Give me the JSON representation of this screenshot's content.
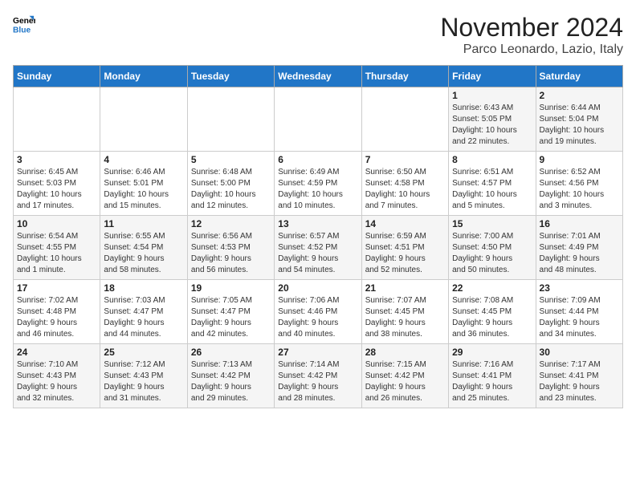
{
  "header": {
    "logo_line1": "General",
    "logo_line2": "Blue",
    "month": "November 2024",
    "location": "Parco Leonardo, Lazio, Italy"
  },
  "days_of_week": [
    "Sunday",
    "Monday",
    "Tuesday",
    "Wednesday",
    "Thursday",
    "Friday",
    "Saturday"
  ],
  "weeks": [
    [
      {
        "day": "",
        "info": ""
      },
      {
        "day": "",
        "info": ""
      },
      {
        "day": "",
        "info": ""
      },
      {
        "day": "",
        "info": ""
      },
      {
        "day": "",
        "info": ""
      },
      {
        "day": "1",
        "info": "Sunrise: 6:43 AM\nSunset: 5:05 PM\nDaylight: 10 hours\nand 22 minutes."
      },
      {
        "day": "2",
        "info": "Sunrise: 6:44 AM\nSunset: 5:04 PM\nDaylight: 10 hours\nand 19 minutes."
      }
    ],
    [
      {
        "day": "3",
        "info": "Sunrise: 6:45 AM\nSunset: 5:03 PM\nDaylight: 10 hours\nand 17 minutes."
      },
      {
        "day": "4",
        "info": "Sunrise: 6:46 AM\nSunset: 5:01 PM\nDaylight: 10 hours\nand 15 minutes."
      },
      {
        "day": "5",
        "info": "Sunrise: 6:48 AM\nSunset: 5:00 PM\nDaylight: 10 hours\nand 12 minutes."
      },
      {
        "day": "6",
        "info": "Sunrise: 6:49 AM\nSunset: 4:59 PM\nDaylight: 10 hours\nand 10 minutes."
      },
      {
        "day": "7",
        "info": "Sunrise: 6:50 AM\nSunset: 4:58 PM\nDaylight: 10 hours\nand 7 minutes."
      },
      {
        "day": "8",
        "info": "Sunrise: 6:51 AM\nSunset: 4:57 PM\nDaylight: 10 hours\nand 5 minutes."
      },
      {
        "day": "9",
        "info": "Sunrise: 6:52 AM\nSunset: 4:56 PM\nDaylight: 10 hours\nand 3 minutes."
      }
    ],
    [
      {
        "day": "10",
        "info": "Sunrise: 6:54 AM\nSunset: 4:55 PM\nDaylight: 10 hours\nand 1 minute."
      },
      {
        "day": "11",
        "info": "Sunrise: 6:55 AM\nSunset: 4:54 PM\nDaylight: 9 hours\nand 58 minutes."
      },
      {
        "day": "12",
        "info": "Sunrise: 6:56 AM\nSunset: 4:53 PM\nDaylight: 9 hours\nand 56 minutes."
      },
      {
        "day": "13",
        "info": "Sunrise: 6:57 AM\nSunset: 4:52 PM\nDaylight: 9 hours\nand 54 minutes."
      },
      {
        "day": "14",
        "info": "Sunrise: 6:59 AM\nSunset: 4:51 PM\nDaylight: 9 hours\nand 52 minutes."
      },
      {
        "day": "15",
        "info": "Sunrise: 7:00 AM\nSunset: 4:50 PM\nDaylight: 9 hours\nand 50 minutes."
      },
      {
        "day": "16",
        "info": "Sunrise: 7:01 AM\nSunset: 4:49 PM\nDaylight: 9 hours\nand 48 minutes."
      }
    ],
    [
      {
        "day": "17",
        "info": "Sunrise: 7:02 AM\nSunset: 4:48 PM\nDaylight: 9 hours\nand 46 minutes."
      },
      {
        "day": "18",
        "info": "Sunrise: 7:03 AM\nSunset: 4:47 PM\nDaylight: 9 hours\nand 44 minutes."
      },
      {
        "day": "19",
        "info": "Sunrise: 7:05 AM\nSunset: 4:47 PM\nDaylight: 9 hours\nand 42 minutes."
      },
      {
        "day": "20",
        "info": "Sunrise: 7:06 AM\nSunset: 4:46 PM\nDaylight: 9 hours\nand 40 minutes."
      },
      {
        "day": "21",
        "info": "Sunrise: 7:07 AM\nSunset: 4:45 PM\nDaylight: 9 hours\nand 38 minutes."
      },
      {
        "day": "22",
        "info": "Sunrise: 7:08 AM\nSunset: 4:45 PM\nDaylight: 9 hours\nand 36 minutes."
      },
      {
        "day": "23",
        "info": "Sunrise: 7:09 AM\nSunset: 4:44 PM\nDaylight: 9 hours\nand 34 minutes."
      }
    ],
    [
      {
        "day": "24",
        "info": "Sunrise: 7:10 AM\nSunset: 4:43 PM\nDaylight: 9 hours\nand 32 minutes."
      },
      {
        "day": "25",
        "info": "Sunrise: 7:12 AM\nSunset: 4:43 PM\nDaylight: 9 hours\nand 31 minutes."
      },
      {
        "day": "26",
        "info": "Sunrise: 7:13 AM\nSunset: 4:42 PM\nDaylight: 9 hours\nand 29 minutes."
      },
      {
        "day": "27",
        "info": "Sunrise: 7:14 AM\nSunset: 4:42 PM\nDaylight: 9 hours\nand 28 minutes."
      },
      {
        "day": "28",
        "info": "Sunrise: 7:15 AM\nSunset: 4:42 PM\nDaylight: 9 hours\nand 26 minutes."
      },
      {
        "day": "29",
        "info": "Sunrise: 7:16 AM\nSunset: 4:41 PM\nDaylight: 9 hours\nand 25 minutes."
      },
      {
        "day": "30",
        "info": "Sunrise: 7:17 AM\nSunset: 4:41 PM\nDaylight: 9 hours\nand 23 minutes."
      }
    ]
  ]
}
